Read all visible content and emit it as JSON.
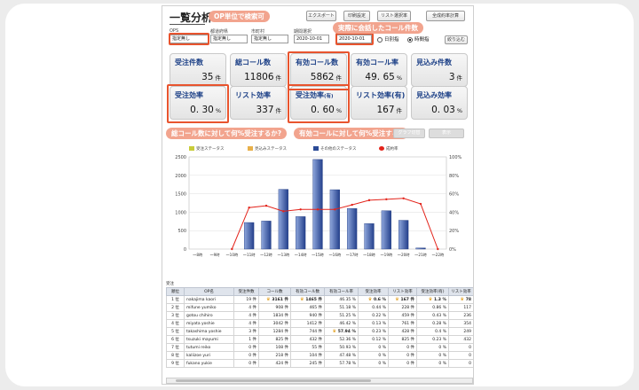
{
  "header": {
    "title": "一覧分析",
    "buttons": [
      "エクスポート",
      "印刷設定",
      "リスト選択率",
      "全成約率計算"
    ]
  },
  "filters": {
    "ops_label": "OPS",
    "ops_value": "指定無し",
    "pref_label": "都道府県",
    "pref_value": "指定無し",
    "city_label": "市町村",
    "city_value": "指定無し",
    "period_label": "期間選択",
    "date_from": "2020-10-01",
    "date_to": "2020-10-01",
    "radio_day": "日別指",
    "radio_time": "時間指",
    "reset_button": "絞り込む"
  },
  "callouts": {
    "op_search": "OP単位で検索可",
    "calls_connected": "実際に会話したコール件数",
    "total_efficiency": "総コール数に対して何%受注するか?",
    "valid_efficiency": "有効コールに対して何%受注する?"
  },
  "kpis": [
    {
      "label": "受注件数",
      "value": "35",
      "unit": "件"
    },
    {
      "label": "総コール数",
      "value": "11806",
      "unit": "件"
    },
    {
      "label": "有効コール数",
      "value": "5862",
      "unit": "件"
    },
    {
      "label": "有効コール率",
      "value": "49. 65",
      "unit": "%"
    },
    {
      "label": "見込み件数",
      "value": "3",
      "unit": "件"
    },
    {
      "label": "受注効率",
      "value": "0. 30",
      "unit": "%"
    },
    {
      "label": "リスト効率",
      "value": "337",
      "unit": "件"
    },
    {
      "label": "受注効率",
      "label_suffix": "(有)",
      "value": "0. 60",
      "unit": "%"
    },
    {
      "label": "リスト効率(有)",
      "value": "167",
      "unit": "件"
    },
    {
      "label": "見込み効率",
      "value": "0. 03",
      "unit": "%"
    }
  ],
  "mini_buttons": [
    "グラフ切替",
    "表示"
  ],
  "legend": [
    {
      "name": "受注ステータス",
      "color": "#c8cc3a"
    },
    {
      "name": "見込みステータス",
      "color": "#e8b04a"
    },
    {
      "name": "その他のステータス",
      "color": "#2b4a96"
    },
    {
      "name": "成約率",
      "color": "#e3241b"
    }
  ],
  "chart_data": {
    "type": "bar",
    "categories": [
      "〜8時",
      "〜9時",
      "〜10時",
      "〜11時",
      "〜12時",
      "〜13時",
      "〜14時",
      "〜15時",
      "〜16時",
      "〜17時",
      "〜18時",
      "〜19時",
      "〜20時",
      "〜21時",
      "〜22時"
    ],
    "ylim": [
      0,
      2500
    ],
    "yticks": [
      "2500",
      "2000",
      "1500",
      "1000",
      "500",
      "0"
    ],
    "y2lim": [
      0,
      100
    ],
    "y2ticks": [
      "100%",
      "80%",
      "60%",
      "40%",
      "20%",
      "0%"
    ],
    "series": [
      {
        "name": "その他のステータス",
        "type": "bar",
        "values": [
          0,
          0,
          0,
          720,
          760,
          1620,
          880,
          2430,
          1610,
          1100,
          690,
          1040,
          780,
          30,
          0
        ]
      },
      {
        "name": "成約率",
        "type": "line",
        "axis": "right",
        "values": [
          null,
          null,
          0,
          45,
          47,
          41,
          43,
          43,
          43,
          48,
          53,
          54,
          55,
          49,
          0
        ]
      }
    ]
  },
  "table": {
    "caption": "受注",
    "headers": [
      "順位",
      "OP名",
      "受注件数",
      "コール数",
      "有効コール数",
      "有効コール率",
      "受注効率",
      "リスト効率",
      "受注効率(有)",
      "リスト効率"
    ],
    "rows": [
      [
        "1 位",
        "nakajima kaori",
        "19 件",
        "3161 件",
        "1465 件",
        "46.35 %",
        "0.6 %",
        "167 件",
        "1.3 %",
        "78"
      ],
      [
        "2 位",
        "mifune yumiko",
        "4 件",
        "908 件",
        "465 件",
        "51.18 %",
        "0.44 %",
        "228 件",
        "0.86 %",
        "117"
      ],
      [
        "3 位",
        "gotou chihiro",
        "4 件",
        "1834 件",
        "940 件",
        "51.25 %",
        "0.22 %",
        "459 件",
        "0.43 %",
        "236"
      ],
      [
        "4 位",
        "miyata yoshie",
        "4 件",
        "3042 件",
        "1412 件",
        "46.42 %",
        "0.13 %",
        "761 件",
        "0.28 %",
        "354"
      ],
      [
        "5 位",
        "takashima yoshie",
        "3 件",
        "1284 件",
        "744 件",
        "57.94 %",
        "0.23 %",
        "428 件",
        "0.4 %",
        "249"
      ],
      [
        "6 位",
        "tsuzuki mayumi",
        "1 件",
        "825 件",
        "432 件",
        "52.36 %",
        "0.12 %",
        "825 件",
        "0.23 %",
        "432"
      ],
      [
        "7 位",
        "tutumi reiko",
        "0 件",
        "108 件",
        "55 件",
        "50.93 %",
        "0 %",
        "0 件",
        "0 %",
        "0"
      ],
      [
        "8 位",
        "kaliizoe yuri",
        "0 件",
        "218 件",
        "104 件",
        "47.48 %",
        "0 %",
        "0 件",
        "0 %",
        "0"
      ],
      [
        "9 位",
        "fukano yukie",
        "0 件",
        "424 件",
        "245 件",
        "57.78 %",
        "0 %",
        "0 件",
        "0 %",
        "0"
      ]
    ],
    "crowned": [
      [
        0,
        3
      ],
      [
        0,
        4
      ],
      [
        4,
        5
      ],
      [
        0,
        6
      ],
      [
        0,
        7
      ],
      [
        0,
        8
      ],
      [
        0,
        9
      ]
    ]
  }
}
